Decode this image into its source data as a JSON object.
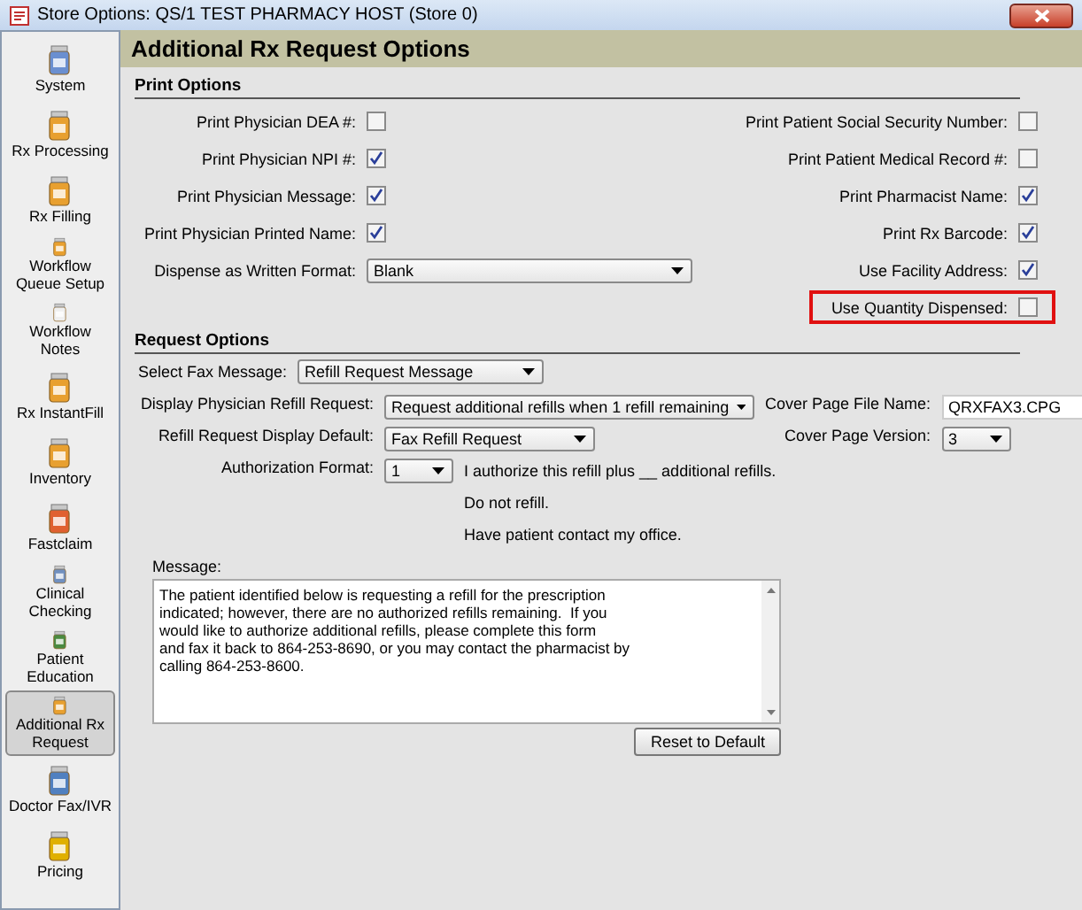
{
  "window": {
    "title": "Store Options: QS/1 TEST PHARMACY HOST (Store 0)"
  },
  "sidebar": {
    "items": [
      {
        "label": "System",
        "selected": false
      },
      {
        "label": "Rx Processing",
        "selected": false
      },
      {
        "label": "Rx Filling",
        "selected": false
      },
      {
        "label": "Workflow\nQueue Setup",
        "selected": false
      },
      {
        "label": "Workflow\nNotes",
        "selected": false
      },
      {
        "label": "Rx InstantFill",
        "selected": false
      },
      {
        "label": "Inventory",
        "selected": false
      },
      {
        "label": "Fastclaim",
        "selected": false
      },
      {
        "label": "Clinical\nChecking",
        "selected": false
      },
      {
        "label": "Patient\nEducation",
        "selected": false
      },
      {
        "label": "Additional Rx\nRequest",
        "selected": true
      },
      {
        "label": "Doctor Fax/IVR",
        "selected": false
      },
      {
        "label": "Pricing",
        "selected": false
      }
    ]
  },
  "header": {
    "title": "Additional Rx Request Options"
  },
  "print_options": {
    "heading": "Print Options",
    "rows": [
      {
        "left": {
          "label": "Print Physician DEA #:",
          "kind": "checkbox",
          "checked": false
        },
        "right": {
          "label": "Print Patient Social Security Number:",
          "checked": false,
          "highlighted": false
        }
      },
      {
        "left": {
          "label": "Print Physician NPI #:",
          "kind": "checkbox",
          "checked": true
        },
        "right": {
          "label": "Print Patient Medical Record #:",
          "checked": false,
          "highlighted": false
        }
      },
      {
        "left": {
          "label": "Print Physician Message:",
          "kind": "checkbox",
          "checked": true
        },
        "right": {
          "label": "Print Pharmacist Name:",
          "checked": true,
          "highlighted": false
        }
      },
      {
        "left": {
          "label": "Print Physician Printed Name:",
          "kind": "checkbox",
          "checked": true
        },
        "right": {
          "label": "Print Rx Barcode:",
          "checked": true,
          "highlighted": false
        }
      },
      {
        "left": {
          "label": "Dispense as Written Format:",
          "kind": "dropdown",
          "value": "Blank"
        },
        "right": {
          "label": "Use Facility Address:",
          "checked": true,
          "highlighted": false
        }
      },
      {
        "right": {
          "label": "Use Quantity Dispensed:",
          "checked": false,
          "highlighted": true
        }
      }
    ]
  },
  "request_options": {
    "heading": "Request Options",
    "fax_message": {
      "label": "Select Fax Message:",
      "value": "Refill Request Message"
    },
    "display_refill": {
      "label": "Display Physician Refill Request:",
      "value": "Request additional refills when 1 refill remaining"
    },
    "cover_file": {
      "label": "Cover Page File Name:",
      "value": "QRXFAX3.CPG"
    },
    "display_default": {
      "label": "Refill Request Display Default:",
      "value": "Fax Refill Request"
    },
    "cover_version": {
      "label": "Cover Page Version:",
      "value": "3"
    },
    "authorization": {
      "label": "Authorization Format:",
      "value": "1"
    },
    "auth_lines": [
      "I authorize this refill plus __ additional refills.",
      "Do not refill.",
      "Have patient contact my office."
    ],
    "message": {
      "label": "Message:",
      "value": "The patient identified below is requesting a refill for the prescription\nindicated; however, there are no authorized refills remaining.  If you\nwould like to authorize additional refills, please complete this form\nand fax it back to 864-253-8690, or you may contact the pharmacist by\ncalling 864-253-8600."
    },
    "reset_button": "Reset to Default"
  }
}
